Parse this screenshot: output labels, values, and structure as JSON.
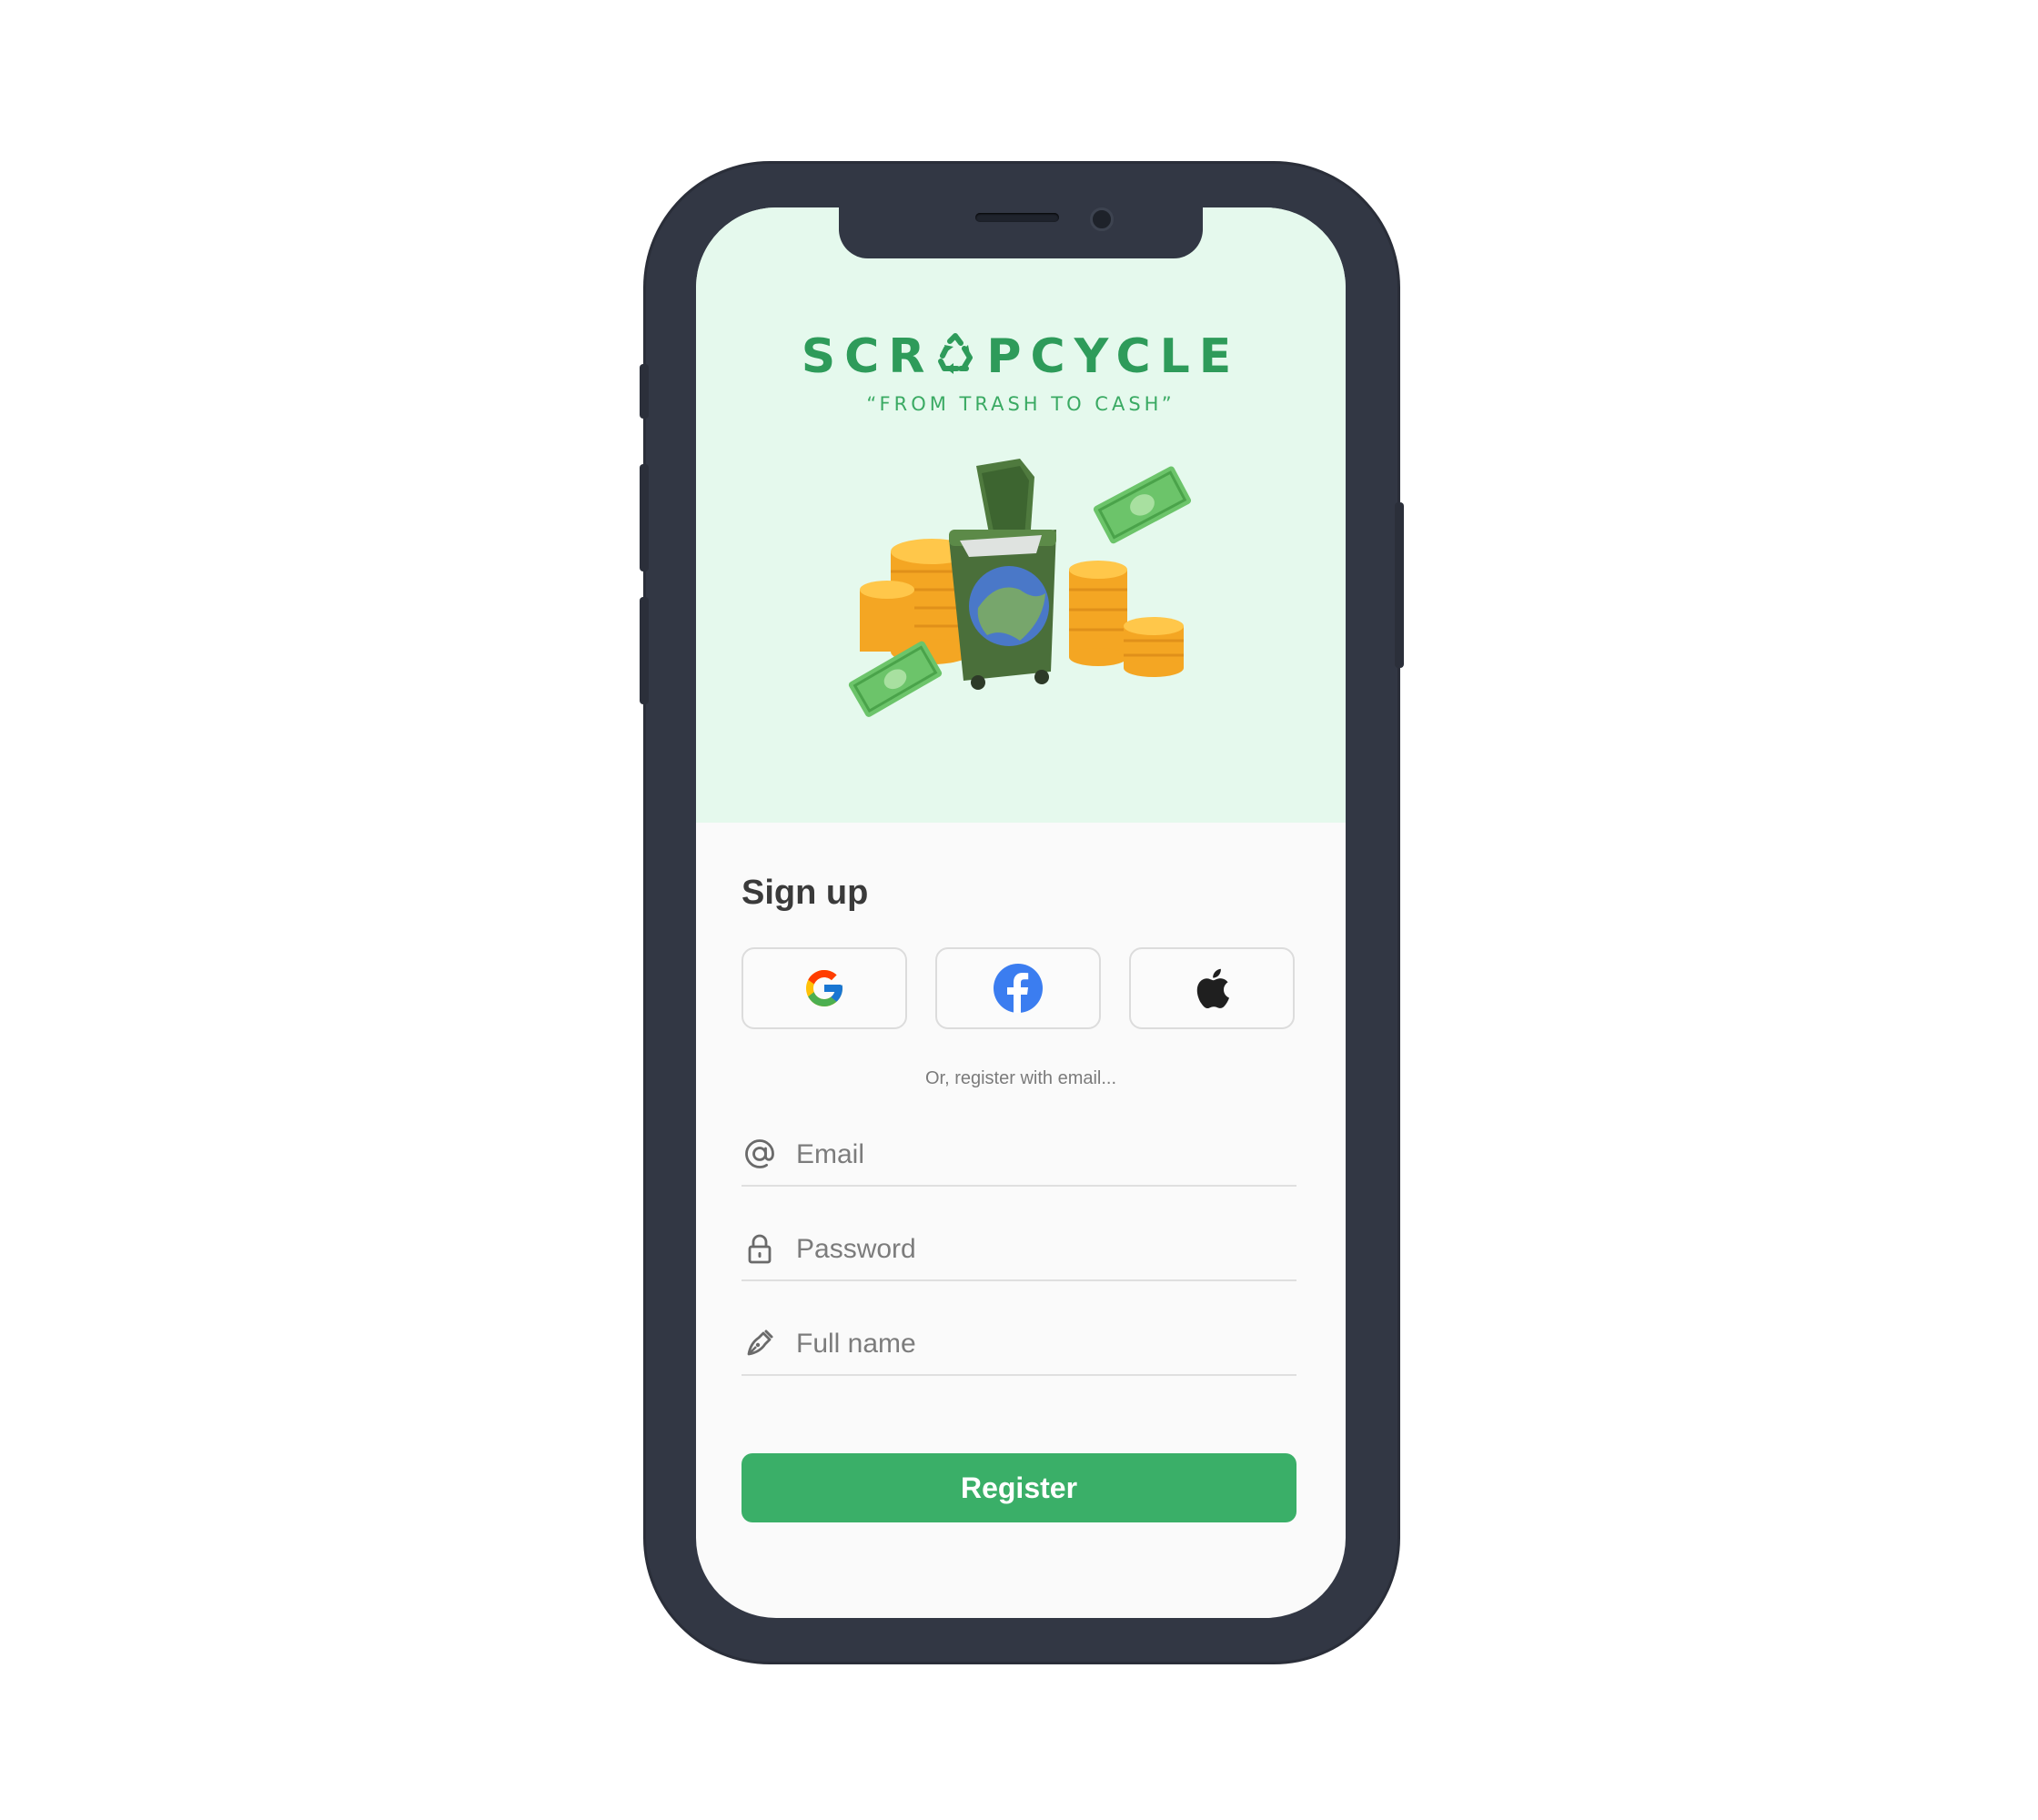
{
  "app": {
    "logo_text": "SCRAPCYCLE",
    "tagline": "“FROM TRASH TO CASH”",
    "brand_color": "#2e9b5a"
  },
  "signup": {
    "title": "Sign up",
    "social": [
      {
        "name": "Google",
        "icon": "google-icon"
      },
      {
        "name": "Facebook",
        "icon": "facebook-icon"
      },
      {
        "name": "Apple",
        "icon": "apple-icon"
      }
    ],
    "divider_text": "Or, register with email...",
    "fields": {
      "email": {
        "placeholder": "Email",
        "icon": "at-icon",
        "value": ""
      },
      "password": {
        "placeholder": "Password",
        "icon": "lock-icon",
        "value": ""
      },
      "full_name": {
        "placeholder": "Full name",
        "icon": "pen-icon",
        "value": ""
      }
    },
    "register_label": "Register",
    "accent_color": "#3aaf68"
  }
}
